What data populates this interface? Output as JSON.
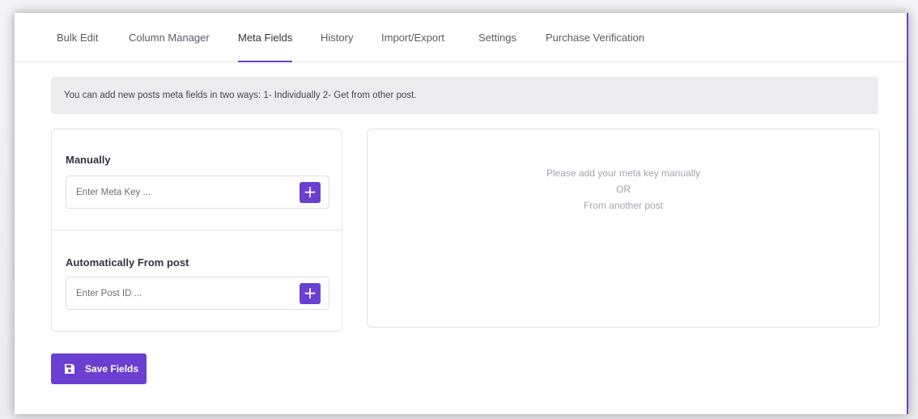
{
  "tabs": [
    {
      "label": "Bulk Edit"
    },
    {
      "label": "Column Manager"
    },
    {
      "label": "Meta Fields"
    },
    {
      "label": "History"
    },
    {
      "label": "Import/Export"
    },
    {
      "label": "Settings"
    },
    {
      "label": "Purchase Verification"
    }
  ],
  "active_tab": "Meta Fields",
  "info": {
    "text": "You can add new posts meta fields in two ways: 1- Individually 2- Get from other post."
  },
  "manual": {
    "title": "Manually",
    "placeholder": "Enter Meta Key ..."
  },
  "auto": {
    "title": "Automatically From post",
    "placeholder": "Enter Post ID ..."
  },
  "plus_glyph": "+",
  "empty_state": {
    "line1": "Please add your meta key manually",
    "line2": "OR",
    "line3": "From another post"
  },
  "save_button": {
    "label": "Save Fields",
    "icon": "floppy-disk-icon"
  },
  "colors": {
    "accent": "#6a3fd1",
    "info_bg": "#ececee",
    "muted_text": "#a3a3ad"
  }
}
